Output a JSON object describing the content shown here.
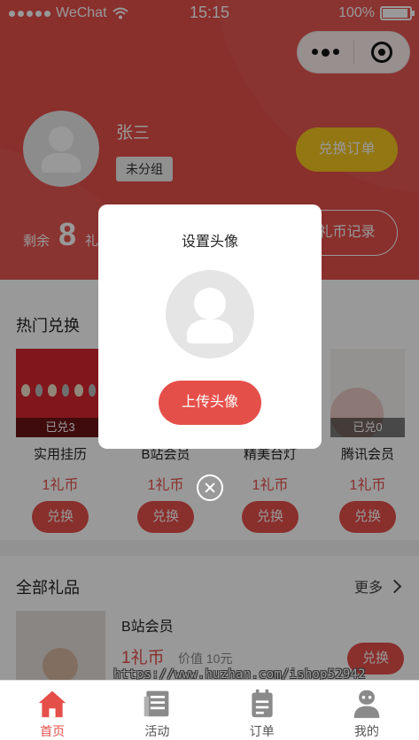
{
  "status_bar": {
    "carrier": "WeChat",
    "time": "15:15",
    "battery": "100%"
  },
  "profile": {
    "name": "张三",
    "group": "未分组",
    "orders_button": "兑换订单",
    "remaining_label": "剩余",
    "remaining_count": "8",
    "remaining_unit": "礼",
    "record_button": "礼币记录"
  },
  "hot": {
    "title": "热门兑换",
    "items": [
      {
        "name": "实用挂历",
        "badge": "已兑3",
        "price": "1礼币",
        "button": "兑换"
      },
      {
        "name": "B站会员",
        "badge": "",
        "price": "1礼币",
        "button": "兑换"
      },
      {
        "name": "精美台灯",
        "badge": "",
        "price": "1礼币",
        "button": "兑换"
      },
      {
        "name": "腾讯会员",
        "badge": "已兑0",
        "price": "1礼币",
        "button": "兑换"
      }
    ]
  },
  "all_gifts": {
    "title": "全部礼品",
    "more": "更多",
    "item": {
      "name": "B站会员",
      "price": "1礼币",
      "original": "价值 10元",
      "button": "兑换"
    }
  },
  "watermark": "https://www.huzhan.com/ishop52942",
  "tabs": [
    {
      "label": "首页",
      "icon": "home-icon",
      "active": true
    },
    {
      "label": "活动",
      "icon": "news-icon",
      "active": false
    },
    {
      "label": "订单",
      "icon": "order-icon",
      "active": false
    },
    {
      "label": "我的",
      "icon": "user-icon",
      "active": false
    }
  ],
  "modal": {
    "title": "设置头像",
    "upload_button": "上传头像"
  },
  "colors": {
    "primary": "#e54f4a",
    "gold": "#f4c61e"
  }
}
